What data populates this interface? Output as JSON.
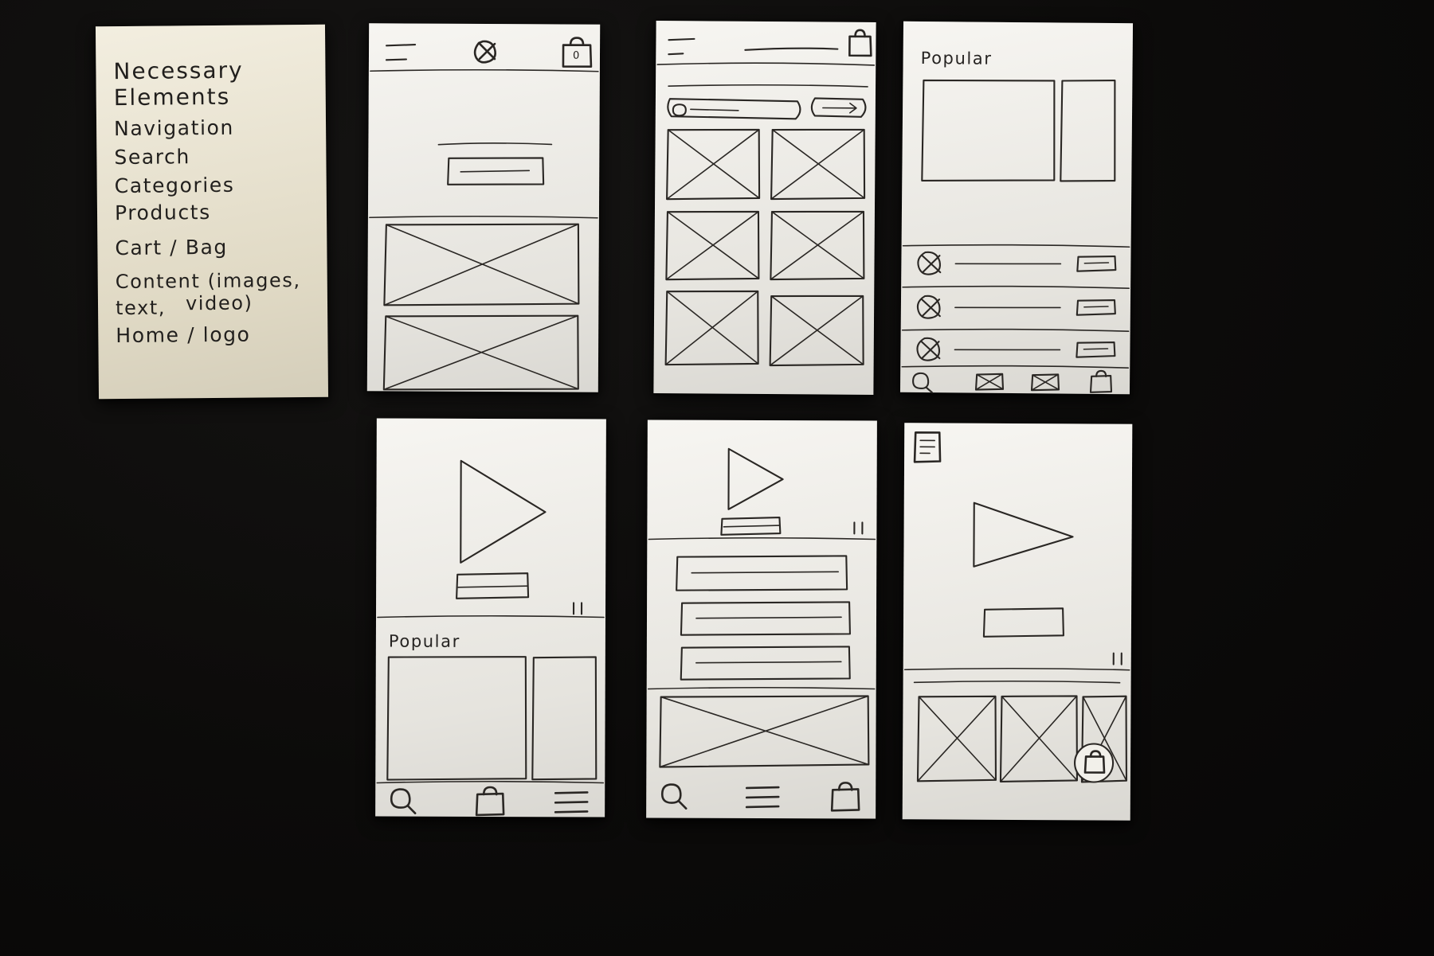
{
  "scene": {
    "surface_color": "#0d0c0b",
    "paper_color": "#f2f0ea",
    "note_paper_color": "#ece5cf",
    "ink_color": "#2a2724"
  },
  "note_card": {
    "name": "necessary-elements-note",
    "title": "Necessary Elements",
    "items": [
      "Navigation",
      "Search",
      "Categories",
      "Products",
      "Cart / Bag",
      "Content (images, text,",
      "Home / logo"
    ],
    "content_second_line": "video)"
  },
  "wireframes": [
    {
      "id": "wf-1",
      "name": "home-screen-wireframe",
      "position": "top-row-1",
      "header": {
        "menu_icon": "hamburger-icon",
        "logo_icon": "circle-x-logo-icon",
        "cart_icon": "shopping-bag-icon",
        "cart_badge": "0"
      },
      "body": {
        "hero_label_line": "text-line",
        "cta_button": "button-placeholder",
        "image_blocks": 2
      }
    },
    {
      "id": "wf-2",
      "name": "category-grid-wireframe",
      "position": "top-row-2",
      "header": {
        "menu_icon": "hamburger-icon",
        "title_line": "text-line",
        "cart_icon": "shopping-bag-icon"
      },
      "controls": {
        "search_field": "search-pill",
        "search_icon": "magnifier-icon",
        "filter_pill": "filter-pill",
        "filter_icon": "arrow-icon"
      },
      "grid": {
        "columns": 2,
        "rows": 3,
        "cells": 6
      }
    },
    {
      "id": "wf-3",
      "name": "popular-list-wireframe",
      "position": "top-row-3",
      "heading": "Popular",
      "hero": {
        "main_block": "image-block",
        "side_block": "image-block"
      },
      "rows": [
        {
          "avatar": "circle-x-icon",
          "text_line": "text-line",
          "action": "pill-button"
        },
        {
          "avatar": "circle-x-icon",
          "text_line": "text-line",
          "action": "pill-button"
        },
        {
          "avatar": "circle-x-icon",
          "text_line": "text-line",
          "action": "pill-button"
        }
      ],
      "tabbar": [
        "search-icon",
        "envelope-icon",
        "envelope-icon",
        "shopping-bag-icon"
      ]
    },
    {
      "id": "wf-4",
      "name": "video-popular-wireframe",
      "position": "bottom-row-1",
      "player": {
        "play_icon": "play-triangle-icon",
        "caption_button": "button-placeholder"
      },
      "scroll_hint": "pause-bars-marker",
      "heading": "Popular",
      "content_blocks": 2,
      "tabbar": [
        "search-icon",
        "shopping-bag-icon",
        "hamburger-menu-icon"
      ]
    },
    {
      "id": "wf-5",
      "name": "video-article-wireframe",
      "position": "bottom-row-2",
      "player": {
        "play_icon": "play-triangle-icon",
        "caption_button": "button-placeholder"
      },
      "scroll_hint": "pause-bars-marker",
      "text_blocks": 3,
      "image_block": "wide-image-block",
      "tabbar": [
        "search-icon",
        "hamburger-menu-icon",
        "shopping-bag-icon"
      ]
    },
    {
      "id": "wf-6",
      "name": "video-products-wireframe",
      "position": "bottom-row-3",
      "doc_icon": "document-list-icon",
      "player": {
        "play_icon": "play-triangle-icon",
        "caption_button": "button-placeholder"
      },
      "scroll_hint": "pause-bars-marker",
      "product_tiles": 3,
      "fab": {
        "icon": "shopping-bag-icon",
        "shape": "circle"
      }
    }
  ]
}
